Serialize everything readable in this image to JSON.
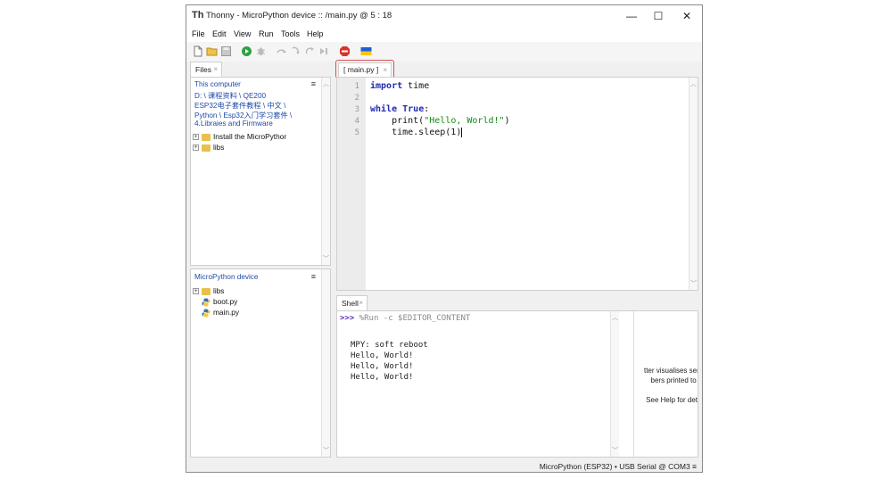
{
  "window": {
    "title": "Thonny  -  MicroPython device :: /main.py  @  5 : 18",
    "icon_glyph": "Th",
    "minimize_glyph": "—",
    "maximize_glyph": "☐",
    "close_glyph": "✕"
  },
  "menu": [
    "File",
    "Edit",
    "View",
    "Run",
    "Tools",
    "Help"
  ],
  "toolbar_icons": [
    "new-file-icon",
    "open-file-icon",
    "save-icon",
    "run-icon",
    "debug-icon",
    "step-over-icon",
    "step-into-icon",
    "step-out-icon",
    "resume-icon",
    "stop-icon",
    "ukraine-flag-icon"
  ],
  "files_panel": {
    "tab_label": "Files",
    "tab_close": "×",
    "menu_glyph": "≡",
    "this_computer": {
      "title": "This computer",
      "path_lines": [
        "D: \\ 课程资料 \\ QE200",
        "ESP32电子套件教程 \\ 中文 \\",
        "Python \\ Esp32入门学习套件 \\",
        "4.Libraies and Firmware"
      ],
      "items": [
        {
          "label": "Install the MicroPythor",
          "type": "folder",
          "expand": "⊞"
        },
        {
          "label": "libs",
          "type": "folder",
          "expand": "⊞"
        }
      ]
    },
    "device": {
      "title": "MicroPython device",
      "items": [
        {
          "label": "libs",
          "type": "folder",
          "expand": "⊞"
        },
        {
          "label": "boot.py",
          "type": "py"
        },
        {
          "label": "main.py",
          "type": "py"
        }
      ]
    }
  },
  "editor": {
    "tab_label": "[ main.py ]",
    "tab_close": "×",
    "line_numbers": [
      "1",
      "2",
      "3",
      "4",
      "5"
    ],
    "lines": {
      "l1_kw": "import",
      "l1_rest": " time",
      "l3_kw": "while",
      "l3_kw2": "True",
      "l3_rest": ":",
      "l4_pre": "    print(",
      "l4_str": "\"Hello, World!\"",
      "l4_post": ")",
      "l5": "    time.sleep(1)"
    }
  },
  "shell": {
    "tab_label": "Shell",
    "tab_close": "×",
    "prompt": ">>>",
    "command": " %Run -c $EDITOR_CONTENT",
    "output": [
      "MPY: soft reboot",
      "Hello, World!",
      "Hello, World!",
      "Hello, World!"
    ],
    "plotter_close": "×",
    "plotter_lines": [
      "tter visualises series",
      "bers printed to the",
      "See Help for details"
    ]
  },
  "statusbar": {
    "text": "MicroPython (ESP32)  •  USB Serial @ COM3  ≡"
  },
  "colors": {
    "keyword": "#1f2bb3",
    "string": "#148a14",
    "highlight_border": "#d9534f",
    "prompt": "#5a2bc0"
  }
}
